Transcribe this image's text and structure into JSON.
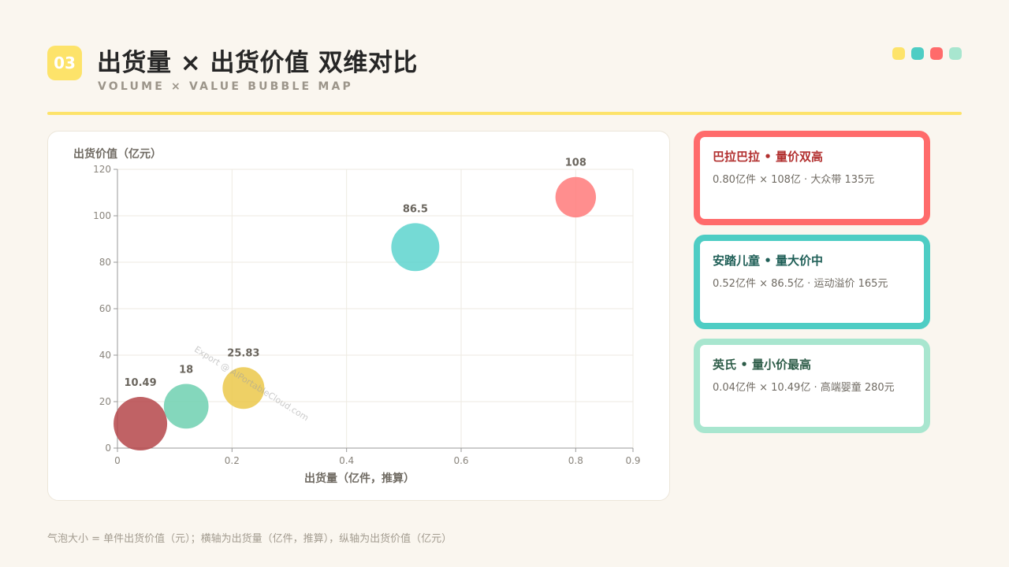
{
  "header": {
    "badge": "03",
    "title": "出货量 × 出货价值 双维对比",
    "subtitle": "VOLUME × VALUE BUBBLE MAP",
    "dot_colors": [
      "#fde36a",
      "#4ecdc4",
      "#ff6b6b",
      "#a8e6cf"
    ]
  },
  "chart_data": {
    "type": "scatter",
    "xlabel": "出货量（亿件，推算）",
    "ylabel": "出货价值（亿元）",
    "xlim": [
      0,
      0.9
    ],
    "ylim": [
      0,
      120
    ],
    "x_ticks": [
      0,
      0.2,
      0.4,
      0.6,
      0.8,
      0.9
    ],
    "x_tick_labels": [
      "0",
      "0.2",
      "0.4",
      "0.6",
      "0.8",
      "0.9"
    ],
    "y_ticks": [
      0,
      20,
      40,
      60,
      80,
      100,
      120
    ],
    "y_tick_labels": [
      "0",
      "20",
      "40",
      "60",
      "80",
      "100",
      "120"
    ],
    "grid": true,
    "points": [
      {
        "x": 0.04,
        "y": 10.49,
        "size": 280,
        "label": "10.49",
        "color": "#b5474a"
      },
      {
        "x": 0.12,
        "y": 18,
        "size": 195,
        "label": "18",
        "color": "#6fd0b0"
      },
      {
        "x": 0.22,
        "y": 25.83,
        "size": 170,
        "label": "25.83",
        "color": "#ebc84a"
      },
      {
        "x": 0.52,
        "y": 86.5,
        "size": 225,
        "label": "86.5",
        "color": "#5dd3ce"
      },
      {
        "x": 0.8,
        "y": 108,
        "size": 160,
        "label": "108",
        "color": "#ff7a7a"
      }
    ],
    "watermark": "Export @ AIPortableCloud.com"
  },
  "cards": [
    {
      "title": "巴拉巴拉 • 量价双高",
      "desc": "0.80亿件 × 108亿 · 大众带 135元",
      "border": "#ff6b6b",
      "title_color": "#b2302f"
    },
    {
      "title": "安踏儿童 • 量大价中",
      "desc": "0.52亿件 × 86.5亿 · 运动溢价 165元",
      "border": "#4ecdc4",
      "title_color": "#1f5f57"
    },
    {
      "title": "英氏 • 量小价最高",
      "desc": "0.04亿件 × 10.49亿 · 高端婴童 280元",
      "border": "#a8e6cf",
      "title_color": "#2d5c48"
    }
  ],
  "footnote": "气泡大小 = 单件出货价值（元）；横轴为出货量（亿件，推算），纵轴为出货价值（亿元）"
}
